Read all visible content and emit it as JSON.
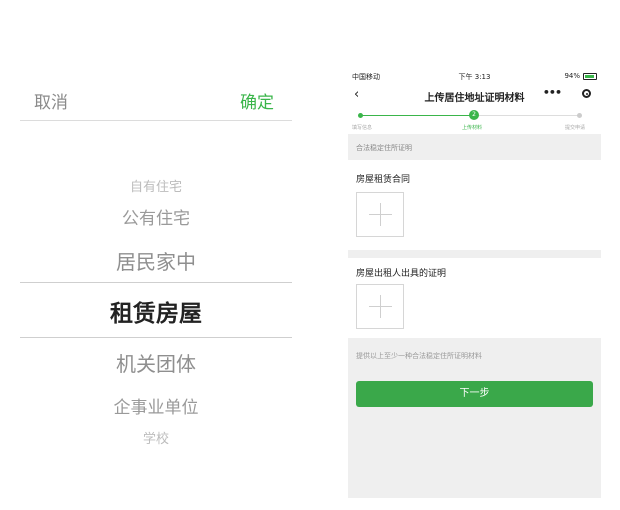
{
  "picker": {
    "cancel_label": "取消",
    "confirm_label": "确定",
    "options": [
      "自有住宅",
      "公有住宅",
      "居民家中",
      "租赁房屋",
      "机关团体",
      "企事业单位",
      "学校"
    ],
    "selected": "租赁房屋",
    "accent_color": "#3ab54a"
  },
  "phone": {
    "status_bar": {
      "carrier": "中国移动",
      "time": "下午 3:13",
      "battery": "94%"
    },
    "nav": {
      "back_icon": "chevron-left-icon",
      "title": "上传居住地址证明材料",
      "more_icon": "more-dots-icon",
      "target_icon": "target-icon"
    },
    "steps": {
      "current_step": "2",
      "labels": [
        "填写信息",
        "上传材料",
        "提交申请"
      ]
    },
    "section_header": "合法稳定住所证明",
    "upload_cards": [
      {
        "title": "房屋租赁合同"
      },
      {
        "title": "房屋出租人出具的证明"
      }
    ],
    "hint": "提供以上至少一种合法稳定住所证明材料",
    "next_button": "下一步",
    "accent_color": "#3aa84a"
  }
}
